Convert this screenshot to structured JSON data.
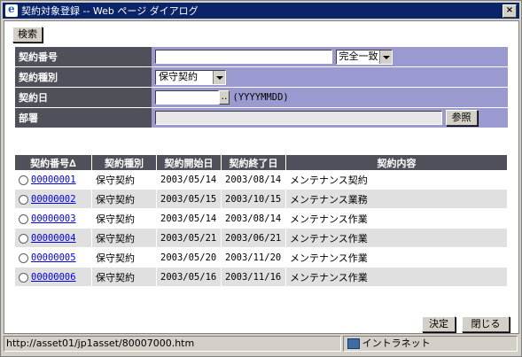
{
  "window": {
    "title": "契約対象登録 -- Web ページ ダイアログ",
    "close": "×"
  },
  "search_button": "検索",
  "form": {
    "contract_no_label": "契約番号",
    "match_select": "完全一致",
    "contract_type_label": "契約種別",
    "contract_type_select": "保守契約",
    "contract_date_label": "契約日",
    "date_button": "..",
    "date_format": "(YYYYMMDD)",
    "department_label": "部署",
    "browse_button": "参照"
  },
  "table": {
    "headers": [
      "契約番号∆",
      "契約種別",
      "契約開始日",
      "契約終了日",
      "契約内容"
    ],
    "rows": [
      {
        "no": "00000001",
        "type": "保守契約",
        "start": "2003/05/14",
        "end": "2003/08/14",
        "content": "メンテナンス契約"
      },
      {
        "no": "00000002",
        "type": "保守契約",
        "start": "2003/05/15",
        "end": "2003/10/15",
        "content": "メンテナンス業務"
      },
      {
        "no": "00000003",
        "type": "保守契約",
        "start": "2003/05/14",
        "end": "2003/08/14",
        "content": "メンテナンス作業"
      },
      {
        "no": "00000004",
        "type": "保守契約",
        "start": "2003/05/21",
        "end": "2003/06/21",
        "content": "メンテナンス作業"
      },
      {
        "no": "00000005",
        "type": "保守契約",
        "start": "2003/05/20",
        "end": "2003/11/20",
        "content": "メンテナンス作業"
      },
      {
        "no": "00000006",
        "type": "保守契約",
        "start": "2003/05/16",
        "end": "2003/11/16",
        "content": "メンテナンス作業"
      }
    ]
  },
  "footer": {
    "ok_button": "決定",
    "close_button": "閉じる"
  },
  "statusbar": {
    "url": "http://asset01/jp1asset/80007000.htm",
    "zone": "イントラネット"
  }
}
